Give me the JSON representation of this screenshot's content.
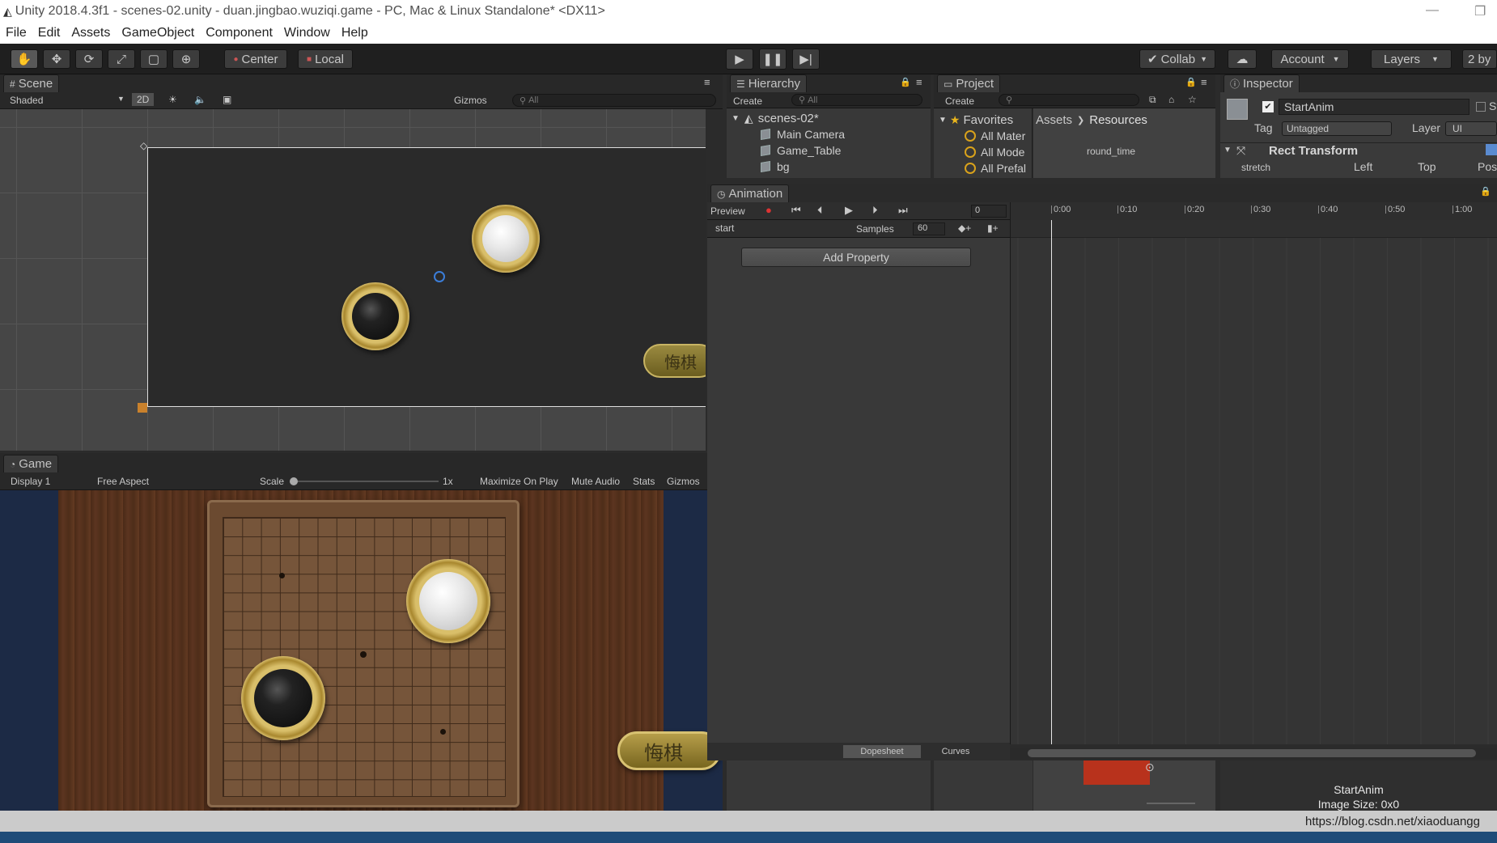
{
  "title_bar": {
    "title": "Unity 2018.4.3f1 - scenes-02.unity - duan.jingbao.wuziqi.game - PC, Mac & Linux Standalone* <DX11>",
    "minimize": "—",
    "restore": "❐"
  },
  "menu": [
    "File",
    "Edit",
    "Assets",
    "GameObject",
    "Component",
    "Window",
    "Help"
  ],
  "toolbar": {
    "tools": [
      "hand-tool",
      "move-tool",
      "rotate-tool",
      "scale-tool",
      "rect-tool",
      "transform-tool"
    ],
    "pivot_center": "Center",
    "pivot_local": "Local",
    "collab": "Collab",
    "account": "Account",
    "layers": "Layers",
    "layout": "2 by"
  },
  "scene": {
    "tab": "Scene",
    "shading": "Shaded",
    "mode_2d": "2D",
    "gizmos": "Gizmos",
    "search_placeholder": "All",
    "button_text": "悔棋"
  },
  "game": {
    "tab": "Game",
    "display": "Display 1",
    "aspect": "Free Aspect",
    "scale_label": "Scale",
    "scale_value": "1x",
    "maximize": "Maximize On Play",
    "mute": "Mute Audio",
    "stats": "Stats",
    "gizmos": "Gizmos",
    "button_text": "悔棋"
  },
  "hierarchy": {
    "tab": "Hierarchy",
    "create": "Create",
    "search_placeholder": "All",
    "scene_name": "scenes-02*",
    "items": [
      "Main Camera",
      "Game_Table",
      "bg"
    ]
  },
  "project": {
    "tab": "Project",
    "create": "Create",
    "favorites": "Favorites",
    "favorite_items": [
      "All Mater",
      "All Mode",
      "All Prefal"
    ],
    "breadcrumb": [
      "Assets",
      "Resources"
    ],
    "asset": "round_time"
  },
  "inspector": {
    "tab": "Inspector",
    "object_name": "StartAnim",
    "static_label": "St",
    "tag_label": "Tag",
    "tag_value": "Untagged",
    "layer_label": "Layer",
    "layer_value": "UI",
    "component": "Rect Transform",
    "anchor": "stretch",
    "columns": [
      "Left",
      "Top",
      "Pos"
    ],
    "preview_name": "StartAnim",
    "preview_size": "Image Size: 0x0"
  },
  "animation": {
    "tab": "Animation",
    "preview": "Preview",
    "frame": "0",
    "clip": "start",
    "samples_label": "Samples",
    "samples_value": "60",
    "add_property": "Add Property",
    "timeline": [
      "0:00",
      "0:10",
      "0:20",
      "0:30",
      "0:40",
      "0:50",
      "1:00"
    ],
    "dopesheet": "Dopesheet",
    "curves": "Curves"
  },
  "watermark": "https://blog.csdn.net/xiaoduangg"
}
